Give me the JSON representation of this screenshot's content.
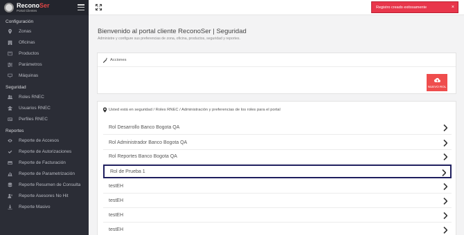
{
  "brand": {
    "name_main": "Recono",
    "name_accent": "Ser",
    "subtitle": "Portal Clientes"
  },
  "sidebar": {
    "sections": [
      {
        "title": "Configuración",
        "items": [
          {
            "label": "Zonas",
            "icon": "map-pin-icon"
          },
          {
            "label": "Oficinas",
            "icon": "building-icon"
          },
          {
            "label": "Productos",
            "icon": "box-icon"
          },
          {
            "label": "Parámetros",
            "icon": "sliders-icon"
          },
          {
            "label": "Máquinas",
            "icon": "monitor-icon"
          }
        ]
      },
      {
        "title": "Seguridad",
        "items": [
          {
            "label": "Roles RNEC",
            "icon": "users-icon"
          },
          {
            "label": "Usuarios RNEC",
            "icon": "user-group-icon"
          },
          {
            "label": "Perfiles RNEC",
            "icon": "id-card-icon"
          }
        ]
      },
      {
        "title": "Reportes",
        "items": [
          {
            "label": "Reporte de Accesos",
            "icon": "eye-icon"
          },
          {
            "label": "Reporte de Autorizaciones",
            "icon": "check-icon"
          },
          {
            "label": "Reporte de Facturación",
            "icon": "credit-card-icon"
          },
          {
            "label": "Reporte de Parametrización",
            "icon": "bar-chart-icon"
          },
          {
            "label": "Reporte Resumen de Consulta",
            "icon": "database-icon"
          },
          {
            "label": "Reporte Asesores No Hit",
            "icon": "user-x-icon"
          },
          {
            "label": "Reporte Masivo",
            "icon": "download-icon"
          }
        ]
      }
    ]
  },
  "toast": {
    "message": "Registro creado exitosamente",
    "close": "×"
  },
  "page": {
    "title": "Bienvenido al portal cliente ReconoSer | Seguridad",
    "subtitle": "Administre y configure sus preferencias de zona, oficina, productos, seguridad y reportes."
  },
  "acciones": {
    "title": "Acciones",
    "new_button_label": "NUEVO ROL"
  },
  "breadcrumb": "Usted está en seguridad / Roles RNEC / Administración y preferencias de los roles para el portal",
  "roles": [
    {
      "name": "Rol Desarrollo Banco Bogota QA",
      "selected": false
    },
    {
      "name": "Rol Administrador Banco Bogota QA",
      "selected": false
    },
    {
      "name": "Rol Reportes Banco Bogota QA",
      "selected": false
    },
    {
      "name": "Rol de Prueba 1",
      "selected": true
    },
    {
      "name": "testEH",
      "selected": false
    },
    {
      "name": "testEH",
      "selected": false
    },
    {
      "name": "testEH",
      "selected": false
    },
    {
      "name": "testEH",
      "selected": false
    }
  ],
  "colors": {
    "sidebar": "#2b2d36",
    "toast": "#e8364b",
    "new_button": "#ef4d4d",
    "selected_border": "#1e1e5e"
  }
}
